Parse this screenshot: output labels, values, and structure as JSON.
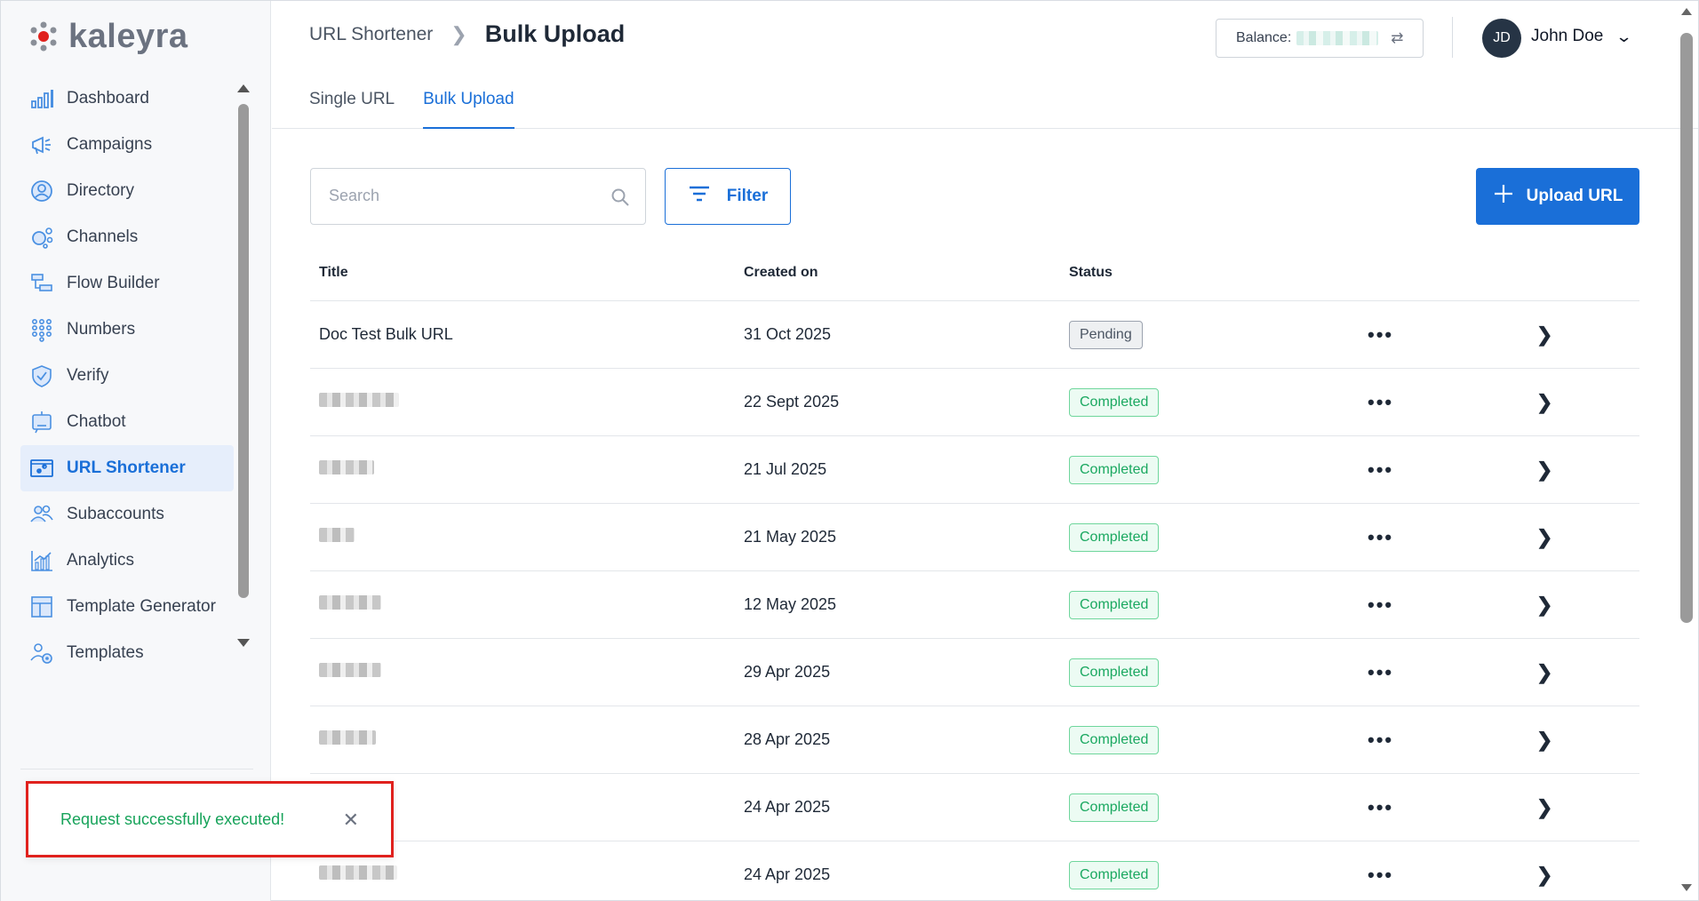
{
  "app": {
    "brand": "kaleyra"
  },
  "sidebar": {
    "items": [
      {
        "label": "Dashboard",
        "icon": "dashboard-icon"
      },
      {
        "label": "Campaigns",
        "icon": "megaphone-icon"
      },
      {
        "label": "Directory",
        "icon": "user-circle-icon"
      },
      {
        "label": "Channels",
        "icon": "channels-icon"
      },
      {
        "label": "Flow Builder",
        "icon": "flow-builder-icon"
      },
      {
        "label": "Numbers",
        "icon": "dialpad-icon"
      },
      {
        "label": "Verify",
        "icon": "shield-check-icon"
      },
      {
        "label": "Chatbot",
        "icon": "bot-icon"
      },
      {
        "label": "URL Shortener",
        "icon": "link-icon",
        "active": true
      },
      {
        "label": "Subaccounts",
        "icon": "users-icon"
      },
      {
        "label": "Analytics",
        "icon": "analytics-icon"
      },
      {
        "label": "Template Generator",
        "icon": "template-icon"
      },
      {
        "label": "Templates",
        "icon": "templates-icon"
      }
    ]
  },
  "header": {
    "breadcrumb_parent": "URL Shortener",
    "breadcrumb_current": "Bulk Upload",
    "balance_label": "Balance:",
    "user_initials": "JD",
    "user_name": "John Doe"
  },
  "tabs": [
    {
      "label": "Single URL",
      "active": false
    },
    {
      "label": "Bulk Upload",
      "active": true
    }
  ],
  "toolbar": {
    "search_placeholder": "Search",
    "filter_label": "Filter",
    "upload_label": "Upload URL"
  },
  "table": {
    "columns": [
      "Title",
      "Created on",
      "Status"
    ],
    "rows": [
      {
        "title": "Doc Test Bulk URL",
        "created_on": "31 Oct 2025",
        "status": "Pending"
      },
      {
        "title": "",
        "created_on": "22 Sept 2025",
        "status": "Completed"
      },
      {
        "title": "",
        "created_on": "21 Jul 2025",
        "status": "Completed"
      },
      {
        "title": "",
        "created_on": "21 May 2025",
        "status": "Completed"
      },
      {
        "title": "",
        "created_on": "12 May 2025",
        "status": "Completed"
      },
      {
        "title": "",
        "created_on": "29 Apr 2025",
        "status": "Completed"
      },
      {
        "title": "",
        "created_on": "28 Apr 2025",
        "status": "Completed"
      },
      {
        "title": "",
        "created_on": "24 Apr 2025",
        "status": "Completed"
      },
      {
        "title": "",
        "created_on": "24 Apr 2025",
        "status": "Completed"
      }
    ]
  },
  "toast": {
    "message": "Request successfully executed!"
  },
  "colors": {
    "accent": "#1a6fd8",
    "success": "#17a35a",
    "toast_border": "#e0211d"
  }
}
